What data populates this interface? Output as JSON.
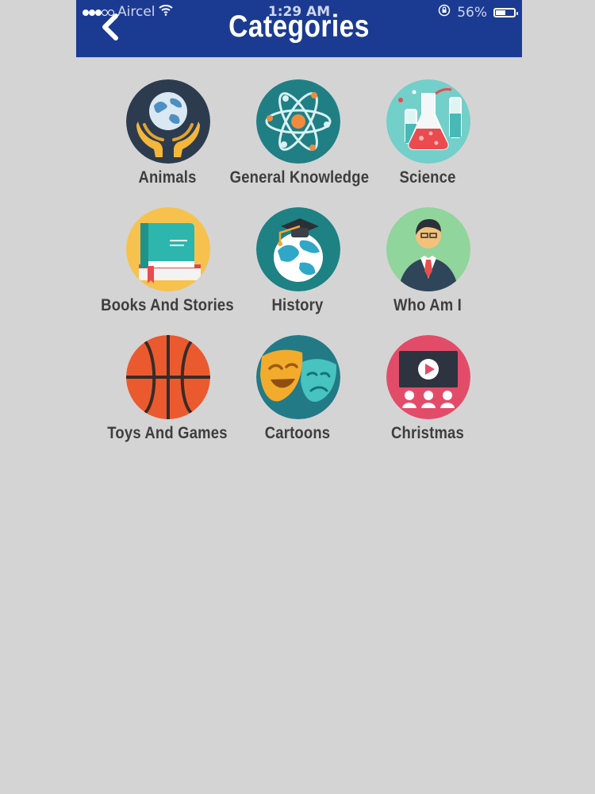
{
  "status_bar": {
    "carrier": "Aircel",
    "time": "1:29 AM",
    "battery": "56%",
    "battery_level": 0.56
  },
  "header": {
    "back_icon": "chevron-left-icon",
    "title": "Categories",
    "background_color": "#1b3b92"
  },
  "categories": [
    {
      "label": "Animals",
      "icon": "earth-in-hands-icon"
    },
    {
      "label": "General Knowledge",
      "icon": "atom-icon"
    },
    {
      "label": "Science",
      "icon": "lab-flasks-icon"
    },
    {
      "label": "Books And Stories",
      "icon": "books-icon"
    },
    {
      "label": "History",
      "icon": "graduation-globe-icon"
    },
    {
      "label": "Who Am I",
      "icon": "person-silhouette-icon"
    },
    {
      "label": "Toys And Games",
      "icon": "basketball-icon"
    },
    {
      "label": "Cartoons",
      "icon": "theater-masks-icon"
    },
    {
      "label": "Christmas",
      "icon": "cinema-screen-icon"
    }
  ],
  "colors": {
    "page_background": "#d4d4d4",
    "label_text": "#3e3e3e"
  }
}
